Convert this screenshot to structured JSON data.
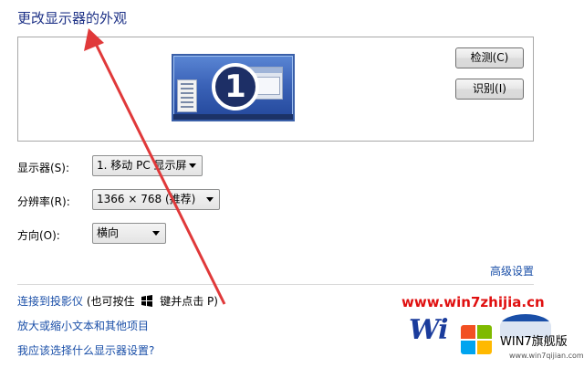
{
  "title": "更改显示器的外观",
  "monitor": {
    "number": "1"
  },
  "buttons": {
    "detect": "检测(C)",
    "identify": "识别(I)"
  },
  "form": {
    "display": {
      "label": "显示器(S):",
      "value": "1. 移动 PC 显示屏"
    },
    "resolution": {
      "label": "分辨率(R):",
      "value": "1366 × 768 (推荐)"
    },
    "orientation": {
      "label": "方向(O):",
      "value": "横向"
    }
  },
  "links": {
    "advanced": "高级设置",
    "projector": "连接到投影仪",
    "projector_hint_pre": "(也可按住",
    "projector_hint_post": "键并点击 P)",
    "enlarge_text": "放大或缩小文本和其他项目",
    "help": "我应该选择什么显示器设置?"
  },
  "watermark": {
    "url": "www.win7zhijia.cn",
    "logo_text": "Wi",
    "badge_text": "WIN7旗舰版",
    "badge_sub": "www.win7qijian.com"
  },
  "colors": {
    "accent": "#1a4fa8",
    "title": "#1e3287",
    "annotation_arrow": "#e0393a",
    "watermark_url": "#e01010"
  },
  "icons": {
    "windows_key": "windows-logo-icon"
  }
}
